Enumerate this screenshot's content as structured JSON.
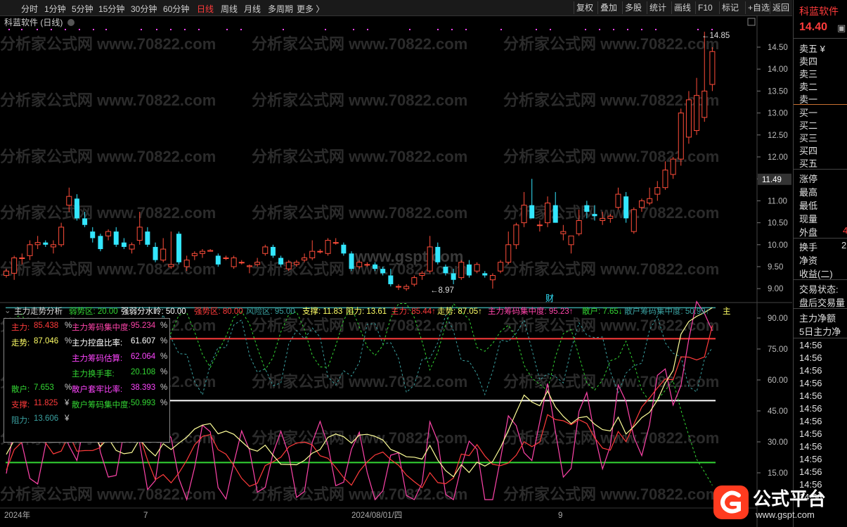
{
  "toolbar": {
    "periods": [
      "分时",
      "1分钟",
      "5分钟",
      "15分钟",
      "30分钟",
      "60分钟",
      "日线",
      "周线",
      "月线",
      "多周期",
      "更多 〉"
    ],
    "active_period": "日线",
    "right_buttons": [
      "复权",
      "叠加",
      "多股",
      "统计",
      "画线",
      "F10",
      "标记",
      "+自选",
      "返回"
    ]
  },
  "chart": {
    "title": "科蓝软件 (日线)",
    "high_label": "14.85",
    "low_label": "8.97",
    "current_price_tag": "11.49",
    "cai_marker": "财",
    "y_axis_ticks": [
      "14.50",
      "14.00",
      "13.50",
      "13.00",
      "12.50",
      "12.00",
      "11.50",
      "11.00",
      "10.50",
      "10.00",
      "9.50",
      "9.00"
    ],
    "x_axis_labels": [
      "2024年",
      "7",
      "2024/08/01/四",
      "9"
    ],
    "watermark_text": "分析家公式网 www.70822.com",
    "watermark_center": "www.gspt.com"
  },
  "indicator": {
    "name": "主力走势分析",
    "legend": [
      {
        "text": "弱势区: 20.00",
        "color": "#33d633"
      },
      {
        "text": "强弱分水岭: 50.00",
        "color": "#ffffff"
      },
      {
        "text": "强势区: 80.00",
        "color": "#ff3b3b"
      },
      {
        "text": "风险区: 95.00",
        "color": "#3aa0a0"
      },
      {
        "text": "支撑: 11.83",
        "color": "#ffff66"
      },
      {
        "text": "阻力: 13.61",
        "color": "#ffff66"
      },
      {
        "text": "主力: 85.44↑",
        "color": "#ff3b3b"
      },
      {
        "text": "走势: 87.05↑",
        "color": "#ffff66"
      },
      {
        "text": "主力筹码集中度: 95.23↑",
        "color": "#ff44aa"
      },
      {
        "text": "散户: 7.65↓",
        "color": "#33d633"
      },
      {
        "text": "散户筹码集中度: 50.99↑",
        "color": "#3aa0a0"
      },
      {
        "text": "主",
        "color": "#ffff66"
      }
    ],
    "y_axis_ticks": [
      "90.00",
      "75.00",
      "60.00",
      "45.00",
      "30.00",
      "15.00"
    ]
  },
  "infobox": {
    "rows": [
      {
        "label": "主力:",
        "value": "85.438",
        "unit": "%",
        "label2": "主力筹码集中度:",
        "value2": "95.234",
        "unit2": "%",
        "c1": "#ff3b3b",
        "c2": "#ff44aa"
      },
      {
        "label": "走势:",
        "value": "87.046",
        "unit": "%",
        "label2": "主力控盘比率:",
        "value2": "61.607",
        "unit2": "%",
        "c1": "#ffff66",
        "c2": "#ffffff"
      },
      {
        "label": "",
        "value": "",
        "unit": "",
        "label2": "主力筹码估算:",
        "value2": "62.064",
        "unit2": "%",
        "c1": "#ffffff",
        "c2": "#ff44ff"
      },
      {
        "label": "",
        "value": "",
        "unit": "",
        "label2": "主力换手率:",
        "value2": "20.108",
        "unit2": "%",
        "c1": "#ffffff",
        "c2": "#33d633"
      },
      {
        "label": "散户:",
        "value": "7.653",
        "unit": "%",
        "label2": "散户套牢比率:",
        "value2": "38.393",
        "unit2": "%",
        "c1": "#33d633",
        "c2": "#ff44ff"
      },
      {
        "label": "支撑:",
        "value": "11.825",
        "unit": "¥",
        "label2": "散户筹码集中度:",
        "value2": "50.993",
        "unit2": "%",
        "c1": "#ff3b3b",
        "c2": "#33d633"
      },
      {
        "label": "阻力:",
        "value": "13.606",
        "unit": "¥",
        "label2": "",
        "value2": "",
        "unit2": "",
        "c1": "#3aa0a0",
        "c2": "#ffffff"
      }
    ]
  },
  "right_panel": {
    "stock_name": "科蓝软件",
    "price": "14.40",
    "sell_levels": [
      "卖五 ¥",
      "卖四",
      "卖三",
      "卖二",
      "卖一"
    ],
    "buy_levels": [
      "买一",
      "买二",
      "买三",
      "买四",
      "买五"
    ],
    "stats": [
      "涨停",
      "最高",
      "最低",
      "现量",
      "外盘"
    ],
    "outer_value": "4",
    "stats2": [
      "换手",
      "净资",
      "收益(二)"
    ],
    "turnover_value": "2",
    "stats3": [
      "交易状态:",
      "盘后交易量"
    ],
    "stats4": [
      "主力净额",
      "5日主力净"
    ],
    "times": [
      "14:56",
      "14:56",
      "14:56",
      "14:56",
      "14:56",
      "14:56",
      "14:56",
      "14:56",
      "14:56",
      "14:56",
      "14:56",
      "14:56",
      "14:56"
    ]
  },
  "logo": {
    "text": "公式平台",
    "url_text": "www.gspt.com"
  },
  "chart_data": {
    "type": "candlestick",
    "candles": [
      [
        9.3,
        9.45,
        9.25,
        9.4
      ],
      [
        9.35,
        9.75,
        9.2,
        9.7
      ],
      [
        9.7,
        9.8,
        9.55,
        9.7
      ],
      [
        9.75,
        10.1,
        9.65,
        10.0
      ],
      [
        10.0,
        10.2,
        9.9,
        10.05
      ],
      [
        10.05,
        10.1,
        9.95,
        10.0
      ],
      [
        9.95,
        10.1,
        9.8,
        10.0
      ],
      [
        10.0,
        10.5,
        9.95,
        10.4
      ],
      [
        10.9,
        11.3,
        10.75,
        11.1
      ],
      [
        11.05,
        11.15,
        10.55,
        10.6
      ],
      [
        10.6,
        10.75,
        10.4,
        10.45
      ],
      [
        10.3,
        10.4,
        10.05,
        10.15
      ],
      [
        10.2,
        10.25,
        9.85,
        9.9
      ],
      [
        10.2,
        10.35,
        10.1,
        10.3
      ],
      [
        10.3,
        10.4,
        9.95,
        10.0
      ],
      [
        10.05,
        10.15,
        9.9,
        9.95
      ],
      [
        9.9,
        10.05,
        9.8,
        10.0
      ],
      [
        10.1,
        10.75,
        10.0,
        10.4
      ],
      [
        10.3,
        10.4,
        9.95,
        10.0
      ],
      [
        9.95,
        10.05,
        9.6,
        9.65
      ],
      [
        9.65,
        10.15,
        9.6,
        9.9
      ],
      [
        9.5,
        10.3,
        9.45,
        9.55
      ],
      [
        10.25,
        10.3,
        9.55,
        9.6
      ],
      [
        9.5,
        9.75,
        9.4,
        9.65
      ],
      [
        9.75,
        9.85,
        9.65,
        9.8
      ],
      [
        9.8,
        9.9,
        9.7,
        9.85
      ],
      [
        9.85,
        9.9,
        9.85,
        9.87
      ],
      [
        9.75,
        9.8,
        9.5,
        9.55
      ],
      [
        9.7,
        9.75,
        9.65,
        9.7
      ],
      [
        9.5,
        9.75,
        9.45,
        9.7
      ],
      [
        9.6,
        9.65,
        9.55,
        9.6
      ],
      [
        9.5,
        9.55,
        9.35,
        9.52
      ],
      [
        9.55,
        9.7,
        9.5,
        9.6
      ],
      [
        9.8,
        10.0,
        9.75,
        9.95
      ],
      [
        9.95,
        10.0,
        9.7,
        9.75
      ],
      [
        9.7,
        9.75,
        9.5,
        9.55
      ],
      [
        9.45,
        9.65,
        9.4,
        9.6
      ],
      [
        9.55,
        9.65,
        9.5,
        9.6
      ],
      [
        9.65,
        9.8,
        9.6,
        9.7
      ],
      [
        9.7,
        10.1,
        9.65,
        9.85
      ],
      [
        9.85,
        9.9,
        9.8,
        9.85
      ],
      [
        9.8,
        10.15,
        9.75,
        10.1
      ],
      [
        10.05,
        10.15,
        10.0,
        10.05
      ],
      [
        10.0,
        10.05,
        9.75,
        9.8
      ],
      [
        9.8,
        9.85,
        9.4,
        9.45
      ],
      [
        9.5,
        9.65,
        9.45,
        9.6
      ],
      [
        9.55,
        9.6,
        9.5,
        9.55
      ],
      [
        9.55,
        9.6,
        9.4,
        9.45
      ],
      [
        9.45,
        9.5,
        9.3,
        9.35
      ],
      [
        9.3,
        9.45,
        9.05,
        9.1
      ],
      [
        9.05,
        9.1,
        8.97,
        9.05
      ],
      [
        9.0,
        9.1,
        8.95,
        9.05
      ],
      [
        9.1,
        9.3,
        9.05,
        9.25
      ],
      [
        9.3,
        9.4,
        9.2,
        9.35
      ],
      [
        9.4,
        10.2,
        9.35,
        9.95
      ],
      [
        9.95,
        10.05,
        9.55,
        9.6
      ],
      [
        9.5,
        9.55,
        9.3,
        9.35
      ],
      [
        9.35,
        9.45,
        9.1,
        9.2
      ],
      [
        9.25,
        9.65,
        9.2,
        9.6
      ],
      [
        9.55,
        9.65,
        9.25,
        9.3
      ],
      [
        9.4,
        9.6,
        9.35,
        9.55
      ],
      [
        9.35,
        9.4,
        9.25,
        9.3
      ],
      [
        9.2,
        9.35,
        9.0,
        9.3
      ],
      [
        9.4,
        9.65,
        9.35,
        9.6
      ],
      [
        9.6,
        10.3,
        9.55,
        10.0
      ],
      [
        10.0,
        10.5,
        9.9,
        10.45
      ],
      [
        10.5,
        11.2,
        10.4,
        10.9
      ],
      [
        10.9,
        11.5,
        10.6,
        10.6
      ],
      [
        10.45,
        10.55,
        10.3,
        10.45
      ],
      [
        10.5,
        11.1,
        10.4,
        10.95
      ],
      [
        10.9,
        11.2,
        10.5,
        10.5
      ],
      [
        10.25,
        10.45,
        10.1,
        10.3
      ],
      [
        10.0,
        10.2,
        9.8,
        10.2
      ],
      [
        10.25,
        10.8,
        10.2,
        10.55
      ],
      [
        10.9,
        11.0,
        10.6,
        10.75
      ],
      [
        10.7,
        10.9,
        10.55,
        10.65
      ],
      [
        10.55,
        10.75,
        10.45,
        10.6
      ],
      [
        10.6,
        10.7,
        10.5,
        10.65
      ],
      [
        10.85,
        11.3,
        10.8,
        11.15
      ],
      [
        11.1,
        11.2,
        10.5,
        10.6
      ],
      [
        10.3,
        10.85,
        10.25,
        10.8
      ],
      [
        10.85,
        11.05,
        10.75,
        11.0
      ],
      [
        10.95,
        11.3,
        10.9,
        11.05
      ],
      [
        11.15,
        11.45,
        11.0,
        11.3
      ],
      [
        11.3,
        11.9,
        11.25,
        11.7
      ],
      [
        11.6,
        12.0,
        11.5,
        11.95
      ],
      [
        11.95,
        13.1,
        11.8,
        13.0
      ],
      [
        12.45,
        13.5,
        12.3,
        13.3
      ],
      [
        12.6,
        13.8,
        12.5,
        13.4
      ],
      [
        12.9,
        14.85,
        12.8,
        13.5
      ],
      [
        13.65,
        14.5,
        13.5,
        14.4
      ]
    ],
    "series": [
      {
        "name": "主力",
        "color": "#ff3b3b"
      },
      {
        "name": "走势",
        "color": "#ffff66"
      },
      {
        "name": "主力筹码集中度",
        "color": "#ff44aa"
      },
      {
        "name": "散户",
        "color": "#33d633"
      },
      {
        "name": "散户筹码集中度",
        "color": "#3aa0a0"
      }
    ],
    "reference_lines": {
      "弱势区": 20,
      "强弱分水岭": 50,
      "强势区": 80,
      "风险区": 95
    },
    "ylim_price": [
      8.8,
      15.0
    ],
    "ylim_indicator": [
      0,
      100
    ]
  }
}
